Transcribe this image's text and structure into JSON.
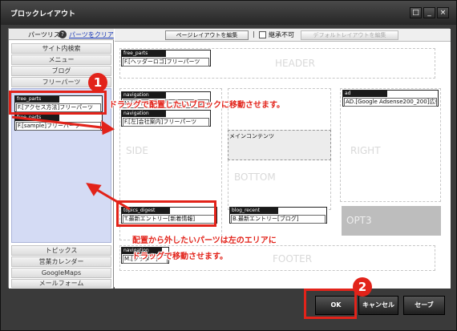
{
  "window": {
    "title": "ブロックレイアウト",
    "buttons": [
      {
        "name": "maximize-button",
        "glyph": "□"
      },
      {
        "name": "minimize-button",
        "glyph": "_"
      },
      {
        "name": "close-button",
        "glyph": "×"
      }
    ]
  },
  "sidebar": {
    "header_label": "パーツリスト",
    "help_icon": "?",
    "clear_link": "パーツをクリア",
    "top_items": [
      "サイト内検索",
      "メニュー",
      "ブログ",
      "フリーパーツ"
    ],
    "parts": [
      {
        "label": "free_parts",
        "value": "F.[アクセス方法]フリーパーツ"
      },
      {
        "label": "free_parts",
        "value": "F.[sample]フリーパーツ"
      }
    ],
    "bottom_items": [
      "トピックス",
      "営業カレンダー",
      "GoogleMaps",
      "メールフォーム"
    ]
  },
  "toolbar": {
    "edit_page_layout": "ページレイアウトを編集",
    "separator": "|",
    "inherit_checkbox": "継承不可",
    "edit_default_layout": "デフォルトレイアウトを編集"
  },
  "zones": {
    "header": "HEADER",
    "side": "SIDE",
    "right": "RIGHT",
    "bottom": "BOTTOM",
    "opt3": "OPT3",
    "footer": "FOOTER",
    "main": "メインコンテンツ"
  },
  "layout_parts": {
    "header_part": {
      "label": "free_parts",
      "value": "F.[ヘッダーロゴ]フリーパーツ"
    },
    "side_nav": {
      "label": "navigation",
      "value": "M.[サイドナビゲーション]グループ"
    },
    "side_nav2": {
      "label": "navigation",
      "value": "F.[左]会社案内]フリーパーツ"
    },
    "topics": {
      "label": "topics_digest",
      "value": "T.最新エントリー[新着情報]"
    },
    "blog": {
      "label": "blog_recent",
      "value": "B.最新エントリー[ブログ]"
    },
    "ad": {
      "label": "ad",
      "value": "AD.[Google Adsense200_200]広告"
    },
    "footer_nav": {
      "label": "navigation",
      "value": "M.[フッター]"
    }
  },
  "annotations": {
    "step1": "1",
    "step2": "2",
    "msg_drag_place": "ドラッグで配置したいブロックに移動させます。",
    "msg_remove_line1": "配置から外したいパーツは左のエリアに",
    "msg_remove_line2": "ドラッグで移動させます。"
  },
  "footer": {
    "ok": "OK",
    "cancel": "キャンセル",
    "save": "セーブ"
  },
  "colors": {
    "annotation_red": "#e2231a",
    "parts_area": "#d4dbf4",
    "dark_chrome": "#2b2b2b"
  }
}
